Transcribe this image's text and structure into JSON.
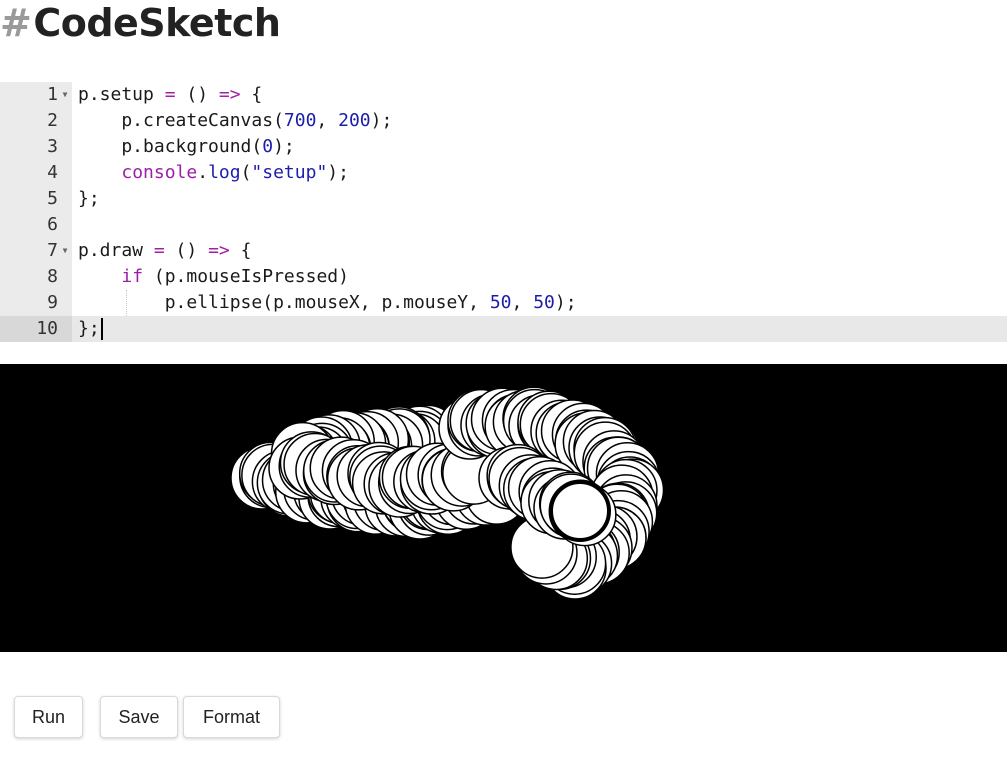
{
  "page": {
    "title_hash": "#",
    "title_text": "CodeSketch"
  },
  "editor": {
    "lines": [
      {
        "number": "1",
        "foldable": true
      },
      {
        "number": "2",
        "foldable": false
      },
      {
        "number": "3",
        "foldable": false
      },
      {
        "number": "4",
        "foldable": false
      },
      {
        "number": "5",
        "foldable": false
      },
      {
        "number": "6",
        "foldable": false
      },
      {
        "number": "7",
        "foldable": true
      },
      {
        "number": "8",
        "foldable": false
      },
      {
        "number": "9",
        "foldable": false
      },
      {
        "number": "10",
        "foldable": false
      }
    ],
    "active_line": "10",
    "code": {
      "l1_a": "p.setup ",
      "l1_eq": "=",
      "l1_b": " () ",
      "l1_arrow": "=>",
      "l1_c": " {",
      "l2_a": "    p.createCanvas(",
      "l2_n1": "700",
      "l2_b": ", ",
      "l2_n2": "200",
      "l2_c": ");",
      "l3_a": "    p.background(",
      "l3_n": "0",
      "l3_b": ");",
      "l4_kw": "console",
      "l4_dot": ".",
      "l4_fn": "log",
      "l4_a": "(",
      "l4_str": "\"setup\"",
      "l4_b": ");",
      "l5": "};",
      "l6": "",
      "l7_a": "p.draw ",
      "l7_eq": "=",
      "l7_b": " () ",
      "l7_arrow": "=>",
      "l7_c": " {",
      "l8_kw": "if",
      "l8_a": " (p.mouseIsPressed)",
      "l9_a": "p.ellipse(p.mouseX, p.mouseY, ",
      "l9_n1": "50",
      "l9_b": ", ",
      "l9_n2": "50",
      "l9_c": ");",
      "l10": "};"
    }
  },
  "sketch": {
    "background": "#000000",
    "circle_fill": "#ffffff",
    "circle_stroke": "#000000"
  },
  "buttons": {
    "run": "Run",
    "save": "Save",
    "format": "Format"
  }
}
